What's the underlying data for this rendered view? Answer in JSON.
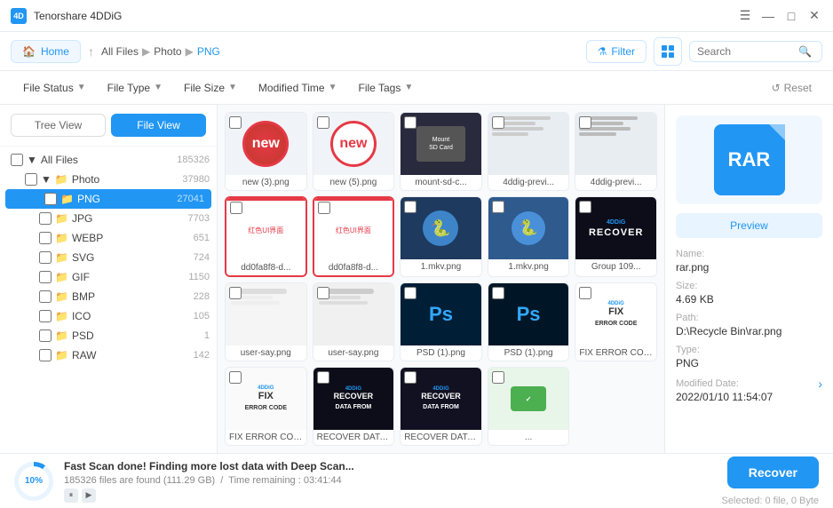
{
  "app": {
    "title": "Tenorshare 4DDiG",
    "logo_text": "4D"
  },
  "title_controls": {
    "minimize": "—",
    "maximize": "□",
    "close": "✕",
    "menu": "☰"
  },
  "nav": {
    "home_label": "Home",
    "back_arrow": "↑",
    "breadcrumb": [
      "All Files",
      "Photo",
      "PNG"
    ],
    "filter_label": "Filter",
    "search_placeholder": "Search"
  },
  "toolbar": {
    "file_status": "File Status",
    "file_type": "File Type",
    "file_size": "File Size",
    "modified_time": "Modified Time",
    "file_tags": "File Tags",
    "reset": "Reset"
  },
  "left_panel": {
    "tree_view_label": "Tree View",
    "file_view_label": "File View",
    "active_view": "file",
    "items": [
      {
        "id": "all-files",
        "label": "All Files",
        "count": "185326",
        "indent": 0,
        "icon": ""
      },
      {
        "id": "photo",
        "label": "Photo",
        "count": "37980",
        "indent": 1,
        "icon": "📁"
      },
      {
        "id": "png",
        "label": "PNG",
        "count": "27041",
        "indent": 2,
        "icon": "📁",
        "active": true
      },
      {
        "id": "jpg",
        "label": "JPG",
        "count": "7703",
        "indent": 2,
        "icon": "📁"
      },
      {
        "id": "webp",
        "label": "WEBP",
        "count": "651",
        "indent": 2,
        "icon": "📁"
      },
      {
        "id": "svg",
        "label": "SVG",
        "count": "724",
        "indent": 2,
        "icon": "📁"
      },
      {
        "id": "gif",
        "label": "GIF",
        "count": "1150",
        "indent": 2,
        "icon": "📁"
      },
      {
        "id": "bmp",
        "label": "BMP",
        "count": "228",
        "indent": 2,
        "icon": "📁"
      },
      {
        "id": "ico",
        "label": "ICO",
        "count": "105",
        "indent": 2,
        "icon": "📁"
      },
      {
        "id": "psd",
        "label": "PSD",
        "count": "1",
        "indent": 2,
        "icon": "📁"
      },
      {
        "id": "raw",
        "label": "RAW",
        "count": "142",
        "indent": 2,
        "icon": "📁"
      }
    ]
  },
  "files": [
    {
      "id": 1,
      "name": "new (3).png",
      "type": "new_red"
    },
    {
      "id": 2,
      "name": "new (5).png",
      "type": "new_red_outline"
    },
    {
      "id": 3,
      "name": "mount-sd-c...",
      "type": "dark_screen"
    },
    {
      "id": 4,
      "name": "4ddig-previ...",
      "type": "file_list"
    },
    {
      "id": 5,
      "name": "4ddig-previ...",
      "type": "file_list2"
    },
    {
      "id": 6,
      "name": "dd0fa8f8-d...",
      "type": "red_ui"
    },
    {
      "id": 7,
      "name": "dd0fa8f8-d...",
      "type": "red_ui2"
    },
    {
      "id": 8,
      "name": "1.mkv.png",
      "type": "python_logo"
    },
    {
      "id": 9,
      "name": "1.mkv.png",
      "type": "python_logo2"
    },
    {
      "id": 10,
      "name": "Group 109...",
      "type": "recover_dark"
    },
    {
      "id": 11,
      "name": "user-say.png",
      "type": "user_form"
    },
    {
      "id": 12,
      "name": "user-say.png",
      "type": "user_form2"
    },
    {
      "id": 13,
      "name": "PSD (1).png",
      "type": "photoshop"
    },
    {
      "id": 14,
      "name": "PSD (1).png",
      "type": "photoshop2"
    },
    {
      "id": 15,
      "name": "FIX ERROR CODE...",
      "type": "fix_dark"
    },
    {
      "id": 16,
      "name": "FIX ERROR CODE...",
      "type": "fix_dark2"
    },
    {
      "id": 17,
      "name": "RECOVER DATA FROM...",
      "type": "recover_dark2"
    },
    {
      "id": 18,
      "name": "RECOVER DATA FROM...",
      "type": "recover_dark3"
    },
    {
      "id": 19,
      "name": "...",
      "type": "green_card"
    }
  ],
  "preview": {
    "preview_btn": "Preview",
    "icon_text": "RAR",
    "name_label": "Name:",
    "name_value": "rar.png",
    "size_label": "Size:",
    "size_value": "4.69 KB",
    "path_label": "Path:",
    "path_value": "D:\\Recycle Bin\\rar.png",
    "type_label": "Type:",
    "type_value": "PNG",
    "modified_label": "Modified Date:",
    "modified_value": "2022/01/10 11:54:07"
  },
  "bottom": {
    "progress_pct": "10%",
    "scan_title": "Fast Scan done! Finding more lost data with Deep Scan...",
    "scan_files": "185326 files are found (111.29 GB)",
    "scan_time": "Time remaining : 03:41:44",
    "recover_label": "Recover",
    "selected_info": "Selected: 0 file, 0 Byte"
  }
}
